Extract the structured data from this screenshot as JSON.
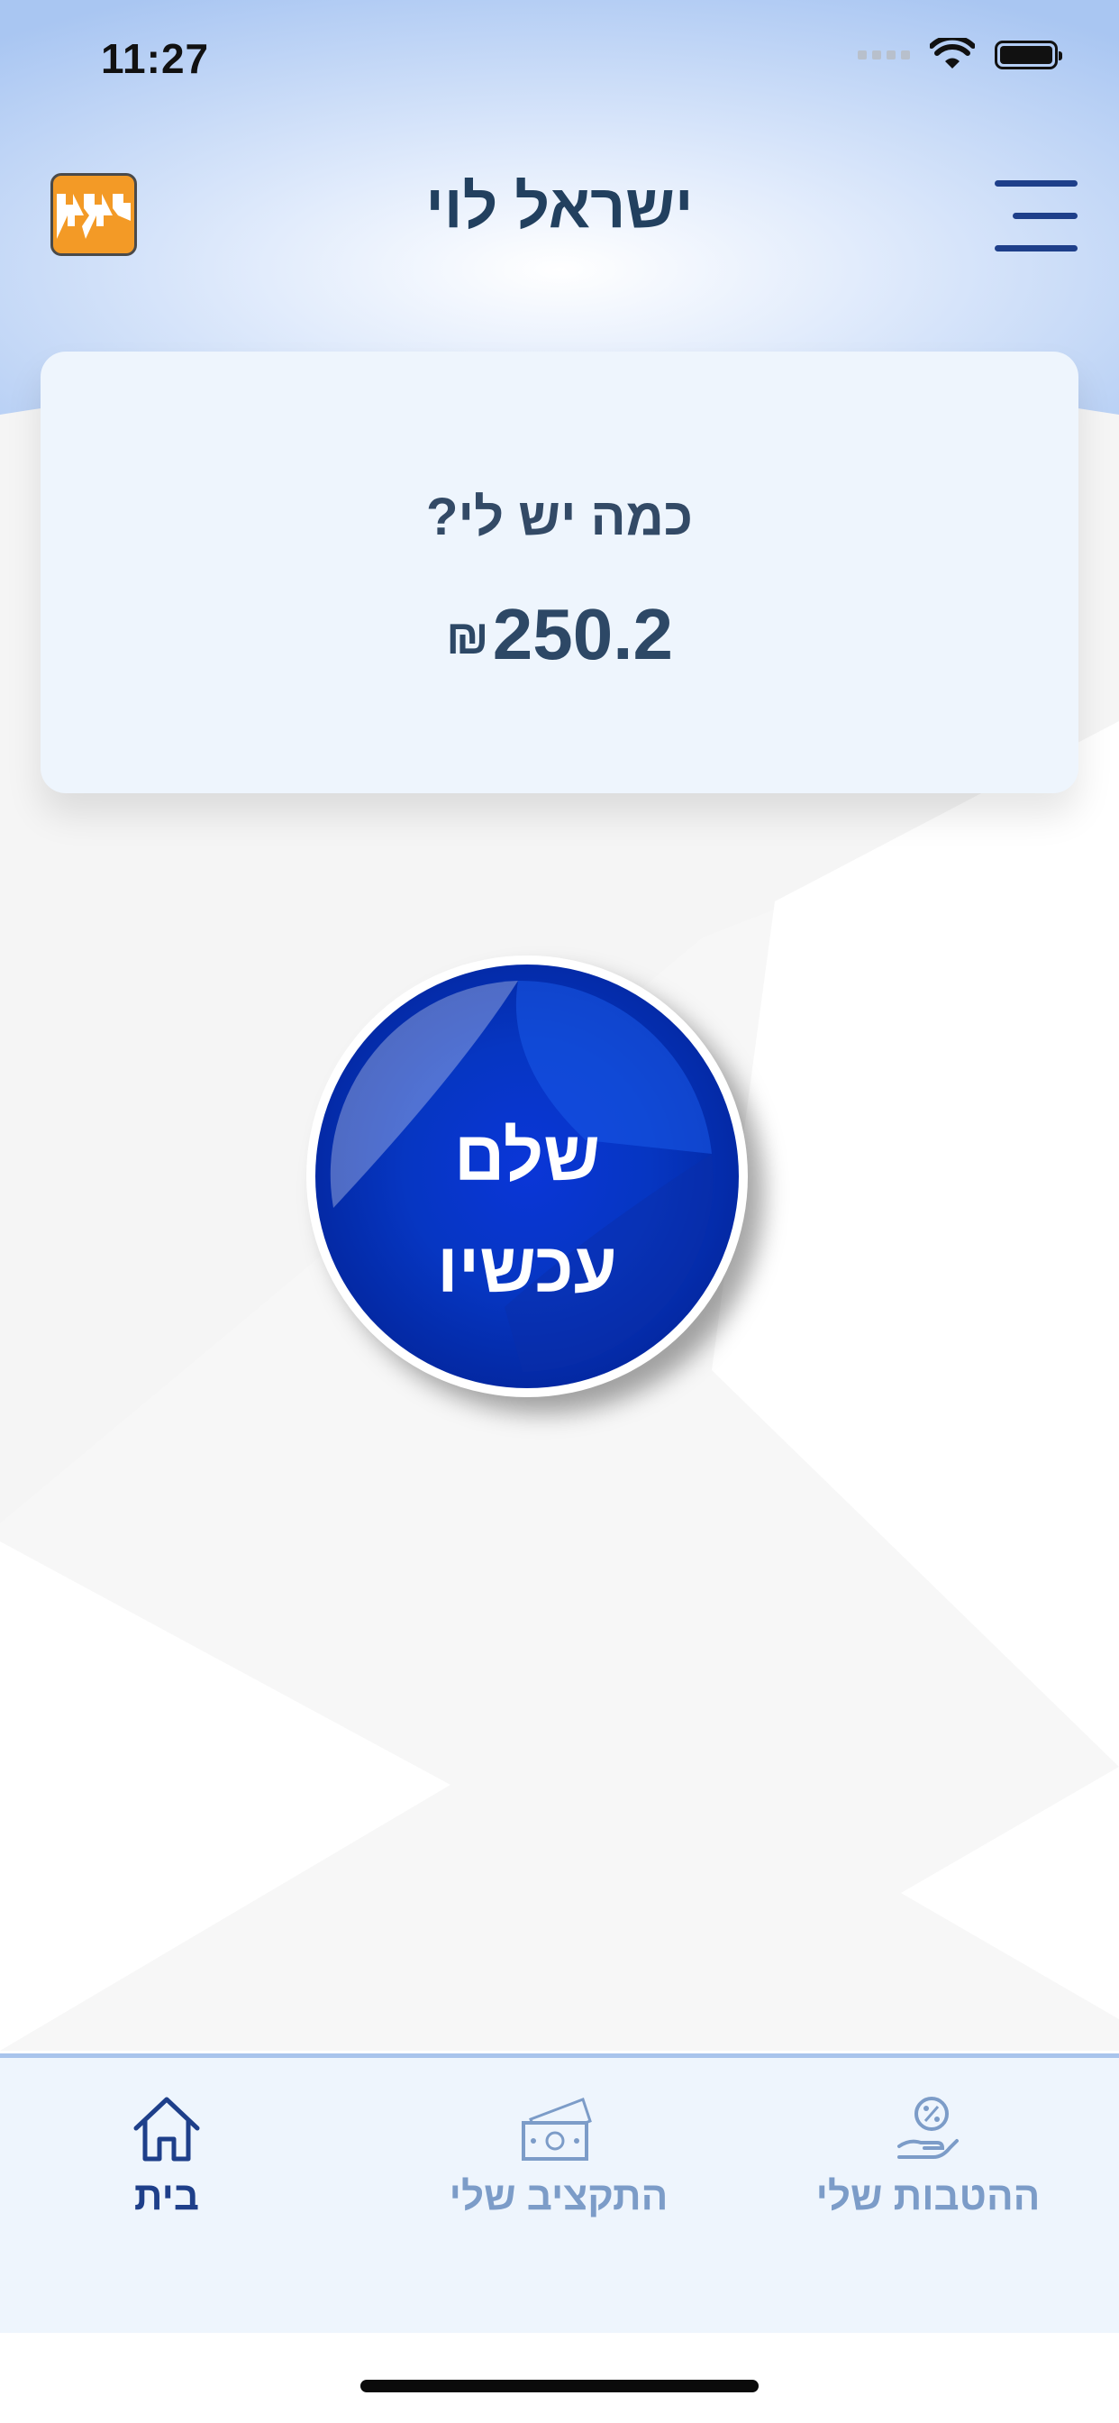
{
  "status_bar": {
    "time": "11:27"
  },
  "header": {
    "title": "ישראל לוי",
    "logo_icon": "app-logo-icon",
    "menu_icon": "hamburger-menu-icon"
  },
  "balance": {
    "label": "כמה יש לי?",
    "amount": "250.2",
    "currency": "₪"
  },
  "pay_button": {
    "line1": "שלם",
    "line2": "עכשיו"
  },
  "bottom_nav": {
    "items": [
      {
        "label": "ההטבות שלי",
        "icon": "benefits-hand-percent-icon",
        "active": false
      },
      {
        "label": "התקציב שלי",
        "icon": "budget-cash-icon",
        "active": false
      },
      {
        "label": "בית",
        "icon": "home-icon",
        "active": true
      }
    ]
  },
  "colors": {
    "header_bg": "#b3cdf5",
    "card_bg": "#eef5fd",
    "pay_button": "#0636c2",
    "active_nav": "#1e3f8a",
    "inactive_nav": "#7c9cc8",
    "logo_orange": "#f39a26"
  }
}
